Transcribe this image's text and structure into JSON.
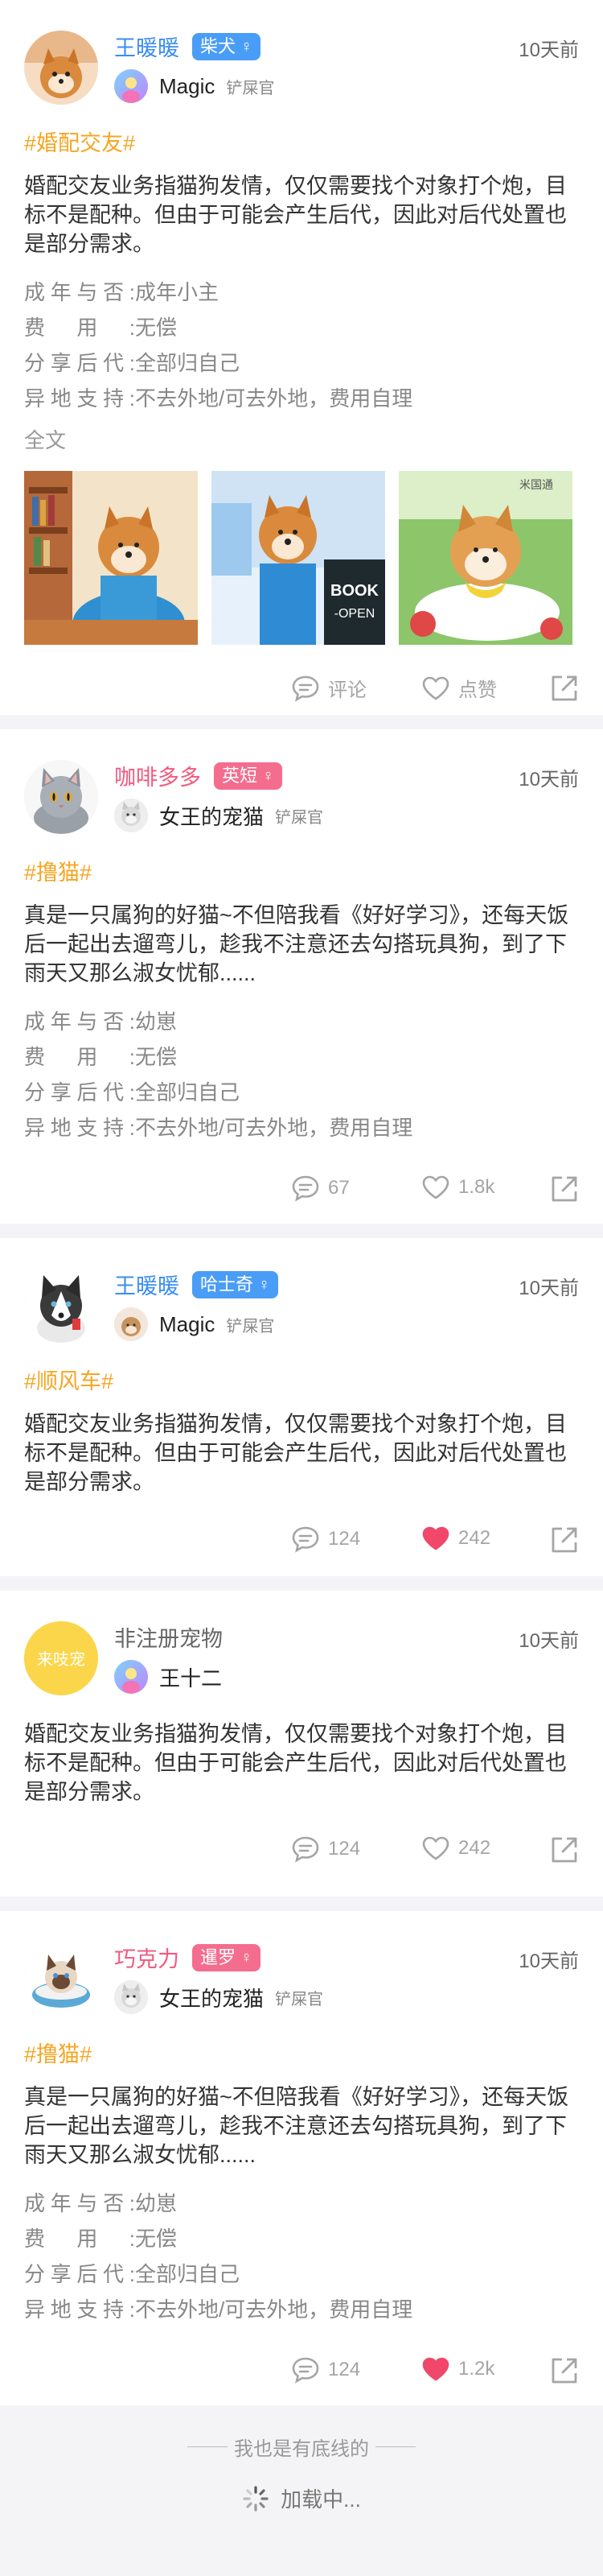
{
  "posts": [
    {
      "nickname": "王暖暖",
      "breed": "柴犬",
      "gender": "♀",
      "time": "10天前",
      "owner": "Magic",
      "role": "铲屎官",
      "topic": "#婚配交友#",
      "content": "婚配交友业务指猫狗发情，仅仅需要找个对象打个炮，目标不是配种。但由于可能会产生后代，因此对后代处置也是部分需求。",
      "specs": [
        {
          "k": "成年与否:",
          "v": "成年小主"
        },
        {
          "k": "费用:",
          "v": "无偿"
        },
        {
          "k": "分享后代:",
          "v": "全部归自己"
        },
        {
          "k": "异地支持:",
          "v": "不去外地/可去外地，费用自理"
        }
      ],
      "fulltext": "全文",
      "photo_text": "BOOK -OPEN",
      "photo3_text": "米国通",
      "comments": "评论",
      "likes": "点赞"
    },
    {
      "nickname": "咖啡多多",
      "breed": "英短",
      "gender": "♀",
      "time": "10天前",
      "owner": "女王的宠猫",
      "role": "铲屎官",
      "topic": "#撸猫#",
      "content": "真是一只属狗的好猫~不但陪我看《好好学习》，还每天饭后一起出去遛弯儿，趁我不注意还去勾搭玩具狗，到了下雨天又那么淑女忧郁......",
      "specs": [
        {
          "k": "成年与否:",
          "v": "幼崽"
        },
        {
          "k": "费用:",
          "v": "无偿"
        },
        {
          "k": "分享后代:",
          "v": "全部归自己"
        },
        {
          "k": "异地支持:",
          "v": "不去外地/可去外地，费用自理"
        }
      ],
      "comments": "67",
      "likes": "1.8k"
    },
    {
      "nickname": "王暖暖",
      "breed": "哈士奇",
      "gender": "♀",
      "time": "10天前",
      "owner": "Magic",
      "role": "铲屎官",
      "topic": "#顺风车#",
      "content": "婚配交友业务指猫狗发情，仅仅需要找个对象打个炮，目标不是配种。但由于可能会产生后代，因此对后代处置也是部分需求。",
      "comments": "124",
      "likes": "242"
    },
    {
      "nickname": "非注册宠物",
      "avatar_text": "来吱宠",
      "time": "10天前",
      "owner": "王十二",
      "content": "婚配交友业务指猫狗发情，仅仅需要找个对象打个炮，目标不是配种。但由于可能会产生后代，因此对后代处置也是部分需求。",
      "comments": "124",
      "likes": "242"
    },
    {
      "nickname": "巧克力",
      "breed": "暹罗",
      "gender": "♀",
      "time": "10天前",
      "owner": "女王的宠猫",
      "role": "铲屎官",
      "topic": "#撸猫#",
      "content": "真是一只属狗的好猫~不但陪我看《好好学习》，还每天饭后一起出去遛弯儿，趁我不注意还去勾搭玩具狗，到了下雨天又那么淑女忧郁......",
      "specs": [
        {
          "k": "成年与否:",
          "v": "幼崽"
        },
        {
          "k": "费用:",
          "v": "无偿"
        },
        {
          "k": "分享后代:",
          "v": "全部归自己"
        },
        {
          "k": "异地支持:",
          "v": "不去外地/可去外地，费用自理"
        }
      ],
      "comments": "124",
      "likes": "1.2k"
    }
  ],
  "footer": {
    "bottom_line": "我也是有底线的",
    "loading": "加载中..."
  },
  "colors": {
    "accent_blue": "#3b8ef0",
    "accent_pink": "#f05a7e",
    "topic_orange": "#f5a623",
    "liked_red": "#f0476a"
  },
  "liked": [
    false,
    false,
    true,
    false,
    true
  ]
}
